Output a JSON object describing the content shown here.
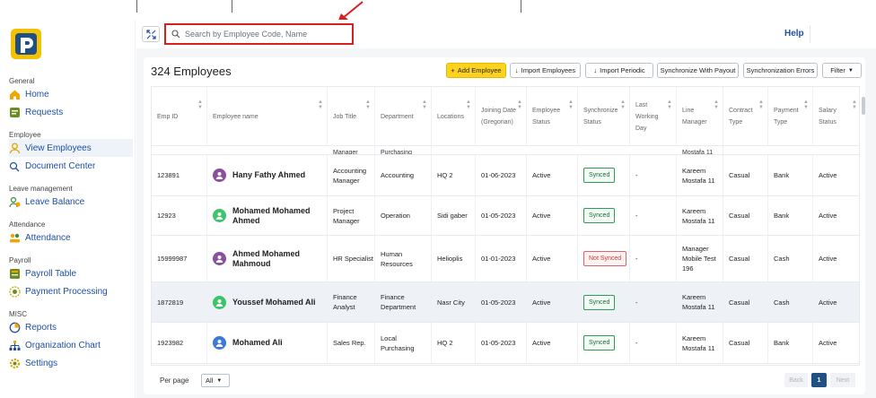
{
  "sidebar": {
    "sections": [
      "General",
      "Employee",
      "Leave management",
      "Attendance",
      "Payroll",
      "MISC"
    ],
    "items": [
      {
        "label": "Home",
        "icon": "home-icon",
        "color": "#f0a500"
      },
      {
        "label": "Requests",
        "icon": "requests-icon",
        "color": "#6b8e23"
      },
      {
        "label": "View Employees",
        "icon": "user-icon",
        "color": "#e0a800",
        "active": true
      },
      {
        "label": "Document Center",
        "icon": "document-icon",
        "color": "#1f4fa3"
      },
      {
        "label": "Leave Balance",
        "icon": "leave-icon",
        "color": "#3a8f3a"
      },
      {
        "label": "Attendance",
        "icon": "attendance-icon",
        "color": "#f0a500"
      },
      {
        "label": "Payroll Table",
        "icon": "payroll-icon",
        "color": "#6b8e23"
      },
      {
        "label": "Payment Processing",
        "icon": "payment-icon",
        "color": "#c8a800"
      },
      {
        "label": "Reports",
        "icon": "reports-icon",
        "color": "#1f4fa3"
      },
      {
        "label": "Organization Chart",
        "icon": "org-chart-icon",
        "color": "#1f4fa3"
      },
      {
        "label": "Settings",
        "icon": "gear-icon",
        "color": "#c8a800"
      }
    ]
  },
  "header": {
    "search_placeholder": "Search by Employee Code, Name",
    "help": "Help"
  },
  "page": {
    "title": "324 Employees",
    "buttons": {
      "add": "Add Employee",
      "import_employees": "Import Employees",
      "import_periodic": "Import Periodic",
      "sync_payout": "Synchronize With Payout",
      "sync_errors": "Synchronization Errors",
      "filter": "Filter"
    }
  },
  "table": {
    "columns": [
      "Emp ID",
      "Employee name",
      "Job Title",
      "Department",
      "Locations",
      "Joining Date (Gregorian)",
      "Employee Status",
      "Synchronize Status",
      "Last Working Day",
      "Line Manager",
      "Contract Type",
      "Payment Type",
      "Salary Status"
    ],
    "partial_row": {
      "job": "Manager",
      "dept": "Purchasing",
      "manager": "Mostafa 11"
    },
    "rows": [
      {
        "id": "123891",
        "name": "Hany Fathy Ahmed",
        "avatar_color": "#8a4f9e",
        "job": "Accounting Manager",
        "dept": "Accounting",
        "loc": "HQ 2",
        "date": "01-06-2023",
        "status": "Active",
        "sync": "Synced",
        "last": "-",
        "manager": "Kareem Mostafa 11",
        "contract": "Casual",
        "payment": "Bank",
        "salary": "Active"
      },
      {
        "id": "12923",
        "name": "Mohamed Mohamed Ahmed",
        "avatar_color": "#3cc46a",
        "job": "Project Manager",
        "dept": "Operation",
        "loc": "Sidi gaber",
        "date": "01-05-2023",
        "status": "Active",
        "sync": "Synced",
        "last": "-",
        "manager": "Kareem Mostafa 11",
        "contract": "Casual",
        "payment": "Bank",
        "salary": "Active"
      },
      {
        "id": "15999987",
        "name": "Ahmed Mohamed Mahmoud",
        "avatar_color": "#8a4f9e",
        "job": "HR Specialist",
        "dept": "Human Resources",
        "loc": "Helioplis",
        "date": "01-01-2023",
        "status": "Active",
        "sync": "Not Synced",
        "last": "-",
        "manager": "Manager Mobile Test 196",
        "contract": "Casual",
        "payment": "Cash",
        "salary": "Active"
      },
      {
        "id": "1872819",
        "name": "Youssef Mohamed Ali",
        "avatar_color": "#3cc46a",
        "job": "Finance Analyst",
        "dept": "Finance Department",
        "loc": "Nasr City",
        "date": "01-05-2023",
        "status": "Active",
        "sync": "Synced",
        "last": "-",
        "manager": "Kareem Mostafa 11",
        "contract": "Casual",
        "payment": "Cash",
        "salary": "Active"
      },
      {
        "id": "1923982",
        "name": "Mohamed Ali",
        "avatar_color": "#3a7bd5",
        "job": "Sales Rep.",
        "dept": "Local Purchasing",
        "loc": "HQ 2",
        "date": "01-05-2023",
        "status": "Active",
        "sync": "Synced",
        "last": "-",
        "manager": "Kareem Mostafa 11",
        "contract": "Casual",
        "payment": "Bank",
        "salary": "Active"
      }
    ]
  },
  "footer": {
    "per_page_label": "Per page",
    "per_page_value": "All",
    "back": "Back",
    "current": "1",
    "next": "Next"
  },
  "colors": {
    "accent": "#ffd21f",
    "primary": "#1f4f83",
    "highlight_border": "#d61f1f"
  }
}
